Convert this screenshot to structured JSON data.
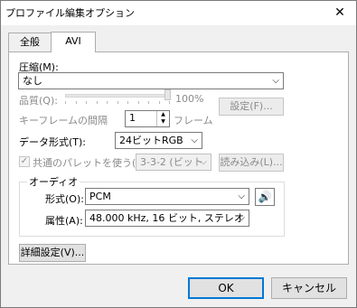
{
  "window": {
    "title": "プロファイル編集オプション",
    "close_glyph": "✕"
  },
  "tabs": [
    {
      "label": "全般",
      "active": false
    },
    {
      "label": "AVI",
      "active": true
    }
  ],
  "compression": {
    "label": "圧縮(M):",
    "value": "なし"
  },
  "quality": {
    "label": "品質(Q):",
    "percent": 100,
    "value_text": "100%",
    "settings_button": "設定(F)..."
  },
  "keyframe": {
    "label": "キーフレームの間隔",
    "value": "1",
    "unit": "フレーム",
    "up": "▲",
    "down": "▼"
  },
  "data_format": {
    "label": "データ形式(T):",
    "value": "24ビットRGB"
  },
  "palette": {
    "label": "共通のパレットを使う(N)",
    "checked": true,
    "check_glyph": "✓",
    "value": "3-3-2 (ビット",
    "load_button": "読み込み(L)..."
  },
  "audio": {
    "group_label": "オーディオ",
    "format_label": "形式(O):",
    "format_value": "PCM",
    "attributes_label": "属性(A):",
    "attributes_value": "48.000 kHz, 16 ビット, ステレオ",
    "speaker_icon": "speaker-icon",
    "speaker_glyph": "🔊"
  },
  "advanced_button": "詳細設定(V)...",
  "footer": {
    "ok": "OK",
    "cancel": "キャンセル"
  },
  "dropdown_glyph": "⌵",
  "colors": {
    "accent": "#0078d7",
    "disabled_text": "#8a8a8a"
  }
}
